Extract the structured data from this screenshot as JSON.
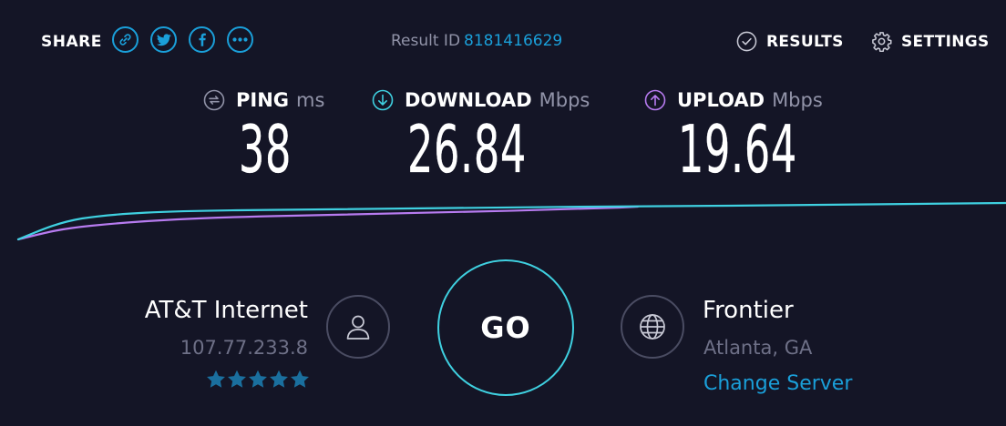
{
  "share": {
    "label": "SHARE",
    "icons": [
      "link-icon",
      "twitter-icon",
      "facebook-icon",
      "more-icon"
    ]
  },
  "result": {
    "label": "Result ID",
    "id": "8181416629"
  },
  "nav": {
    "results_label": "RESULTS",
    "settings_label": "SETTINGS"
  },
  "metrics": {
    "ping": {
      "label": "PING",
      "unit": "ms",
      "value": "38",
      "icon": "ping-icon"
    },
    "download": {
      "label": "DOWNLOAD",
      "unit": "Mbps",
      "value": "26.84",
      "icon": "download-arrow-icon",
      "color": "#3fd0e0"
    },
    "upload": {
      "label": "UPLOAD",
      "unit": "Mbps",
      "value": "19.64",
      "icon": "upload-arrow-icon",
      "color": "#b77bf0"
    }
  },
  "isp": {
    "name": "AT&T Internet",
    "ip": "107.77.233.8",
    "rating_stars": 5,
    "star_color": "#1a6f9e"
  },
  "go": {
    "label": "GO"
  },
  "server": {
    "name": "Frontier",
    "location": "Atlanta, GA",
    "change_label": "Change Server"
  },
  "colors": {
    "background": "#141526",
    "accent_blue": "#1a9fd9",
    "download_cyan": "#3fd0e0",
    "upload_purple": "#b77bf0",
    "muted_text": "#9193a8"
  }
}
